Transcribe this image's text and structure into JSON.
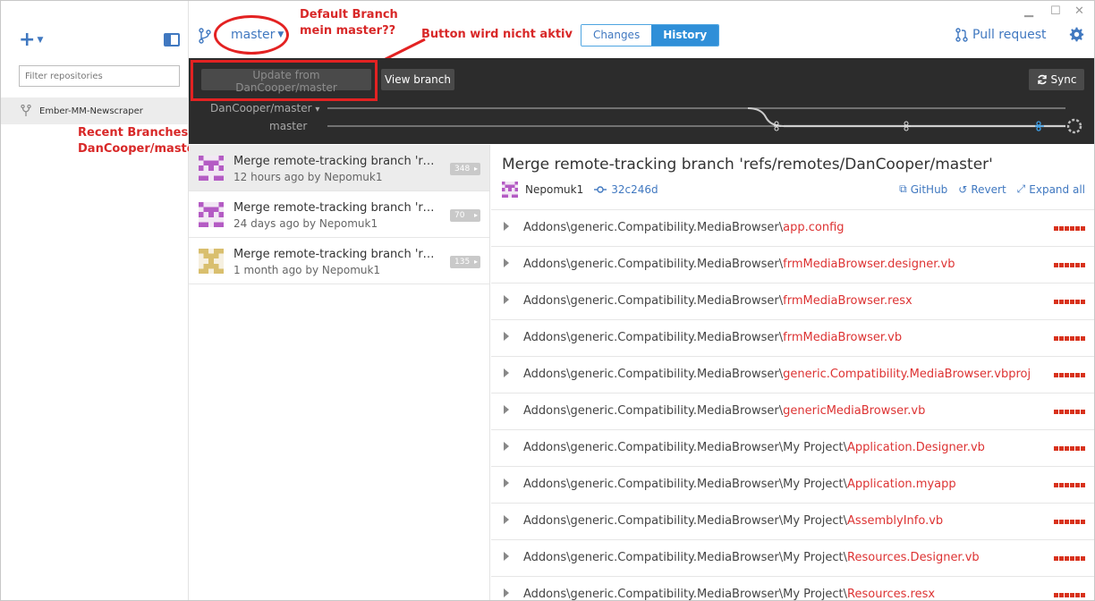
{
  "sidebar": {
    "filter_placeholder": "Filter repositories",
    "repos": [
      {
        "name": "Ember-MM-Newscraper"
      }
    ]
  },
  "header": {
    "branch": "master",
    "tabs": [
      {
        "label": "Changes",
        "active": false
      },
      {
        "label": "History",
        "active": true
      }
    ],
    "pull_request_label": "Pull request"
  },
  "toolbar": {
    "update_label": "Update from DanCooper/master",
    "update_enabled": false,
    "view_branch_label": "View branch",
    "sync_label": "Sync"
  },
  "graph": {
    "branch_labels": [
      "DanCooper/master",
      "master"
    ],
    "branch_caret": "▾"
  },
  "annotations": {
    "default_branch": [
      "Default Branch",
      "mein master??"
    ],
    "button_inactive": "Button wird nicht aktiv",
    "recent_branches": [
      "Recent Branches",
      "DanCooper/master"
    ]
  },
  "commits": [
    {
      "title": "Merge remote-tracking branch 'ref…",
      "meta": "12 hours ago by Nepomuk1",
      "count": "348",
      "selected": true
    },
    {
      "title": "Merge remote-tracking branch 'refs…",
      "meta": "24 days ago by Nepomuk1",
      "count": "70",
      "selected": false
    },
    {
      "title": "Merge remote-tracking branch 'ref…",
      "meta": "1 month ago by Nepomuk1",
      "count": "135",
      "selected": false
    }
  ],
  "detail": {
    "title": "Merge remote-tracking branch 'refs/remotes/DanCooper/master'",
    "author": "Nepomuk1",
    "sha": "32c246d",
    "actions": [
      "GitHub",
      "Revert",
      "Expand all"
    ]
  },
  "files": [
    {
      "dir": "Addons\\generic.Compatibility.MediaBrowser\\",
      "name": "app.config"
    },
    {
      "dir": "Addons\\generic.Compatibility.MediaBrowser\\",
      "name": "frmMediaBrowser.designer.vb"
    },
    {
      "dir": "Addons\\generic.Compatibility.MediaBrowser\\",
      "name": "frmMediaBrowser.resx"
    },
    {
      "dir": "Addons\\generic.Compatibility.MediaBrowser\\",
      "name": "frmMediaBrowser.vb"
    },
    {
      "dir": "Addons\\generic.Compatibility.MediaBrowser\\",
      "name": "generic.Compatibility.MediaBrowser.vbproj"
    },
    {
      "dir": "Addons\\generic.Compatibility.MediaBrowser\\",
      "name": "genericMediaBrowser.vb"
    },
    {
      "dir": "Addons\\generic.Compatibility.MediaBrowser\\My Project\\",
      "name": "Application.Designer.vb"
    },
    {
      "dir": "Addons\\generic.Compatibility.MediaBrowser\\My Project\\",
      "name": "Application.myapp"
    },
    {
      "dir": "Addons\\generic.Compatibility.MediaBrowser\\My Project\\",
      "name": "AssemblyInfo.vb"
    },
    {
      "dir": "Addons\\generic.Compatibility.MediaBrowser\\My Project\\",
      "name": "Resources.Designer.vb"
    },
    {
      "dir": "Addons\\generic.Compatibility.MediaBrowser\\My Project\\",
      "name": "Resources.resx"
    }
  ],
  "colors": {
    "accent": "#4078c0",
    "annotation": "#e32222",
    "deletion": "#d8321c"
  }
}
